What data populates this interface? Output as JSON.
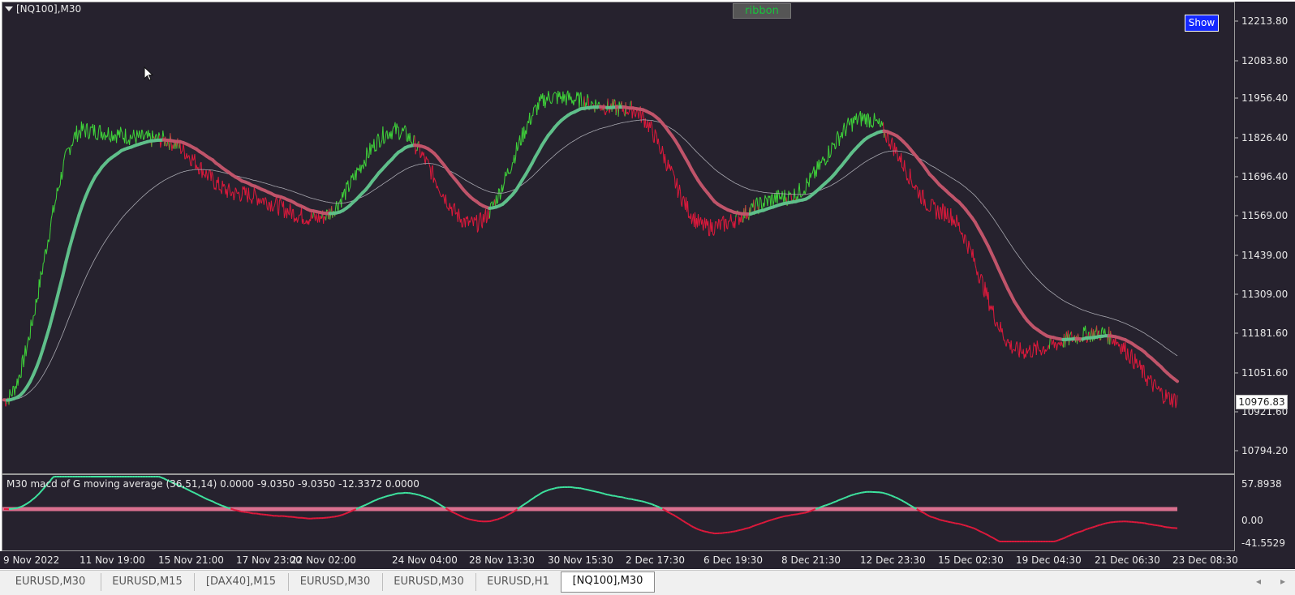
{
  "window": {
    "title": "[NQ100],M30"
  },
  "buttons": {
    "ribbon": "ribbon",
    "show": "Show"
  },
  "price_scale": {
    "labels": [
      "12213.80",
      "12083.80",
      "11956.40",
      "11826.40",
      "11696.40",
      "11569.00",
      "11439.00",
      "11309.00",
      "11181.60",
      "11051.60",
      "10921.60",
      "10794.20"
    ],
    "current_price": "10976.83"
  },
  "indicator": {
    "title": "M30 macd of G moving average (36,51,14) 0.0000 -9.0350 -9.0350 -12.3372 0.0000",
    "scale": [
      "57.8938",
      "0.00",
      "-41.5529"
    ]
  },
  "time_axis": {
    "labels": [
      "9 Nov 2022",
      "11 Nov 19:00",
      "15 Nov 21:00",
      "17 Nov 23:00",
      "22 Nov 02:00",
      "24 Nov 04:00",
      "28 Nov 13:30",
      "30 Nov 15:30",
      "2 Dec 17:30",
      "6 Dec 19:30",
      "8 Dec 21:30",
      "12 Dec 23:30",
      "15 Dec 02:30",
      "19 Dec 04:30",
      "21 Dec 06:30",
      "23 Dec 08:30"
    ]
  },
  "tabs": [
    "EURUSD,M30",
    "EURUSD,M15",
    "[DAX40],M15",
    "EURUSD,M30",
    "EURUSD,M30",
    "EURUSD,H1",
    "[NQ100],M30"
  ],
  "active_tab": "[NQ100],M30",
  "colors": {
    "bull": "#3fd43a",
    "bear": "#e0193c",
    "ribbon_bull": "#5fbf8a",
    "ribbon_bear": "#c0546a",
    "background": "#26222e"
  },
  "chart_data": {
    "type": "line",
    "y_axis": {
      "min": 10794.2,
      "max": 12213.8
    },
    "x_categories": [
      "9 Nov 2022",
      "11 Nov 19:00",
      "15 Nov 21:00",
      "17 Nov 23:00",
      "22 Nov 02:00",
      "24 Nov 04:00",
      "28 Nov 13:30",
      "30 Nov 15:30",
      "2 Dec 17:30",
      "6 Dec 19:30",
      "8 Dec 21:30",
      "12 Dec 23:30",
      "15 Dec 02:30",
      "19 Dec 04:30",
      "21 Dec 06:30",
      "23 Dec 08:30"
    ],
    "series": [
      {
        "values_approx": [
          10960,
          11850,
          11820,
          11640,
          11560,
          11850,
          11540,
          11960,
          11920,
          11530,
          11630,
          11890,
          11580,
          11120,
          11180,
          10960
        ]
      }
    ]
  }
}
